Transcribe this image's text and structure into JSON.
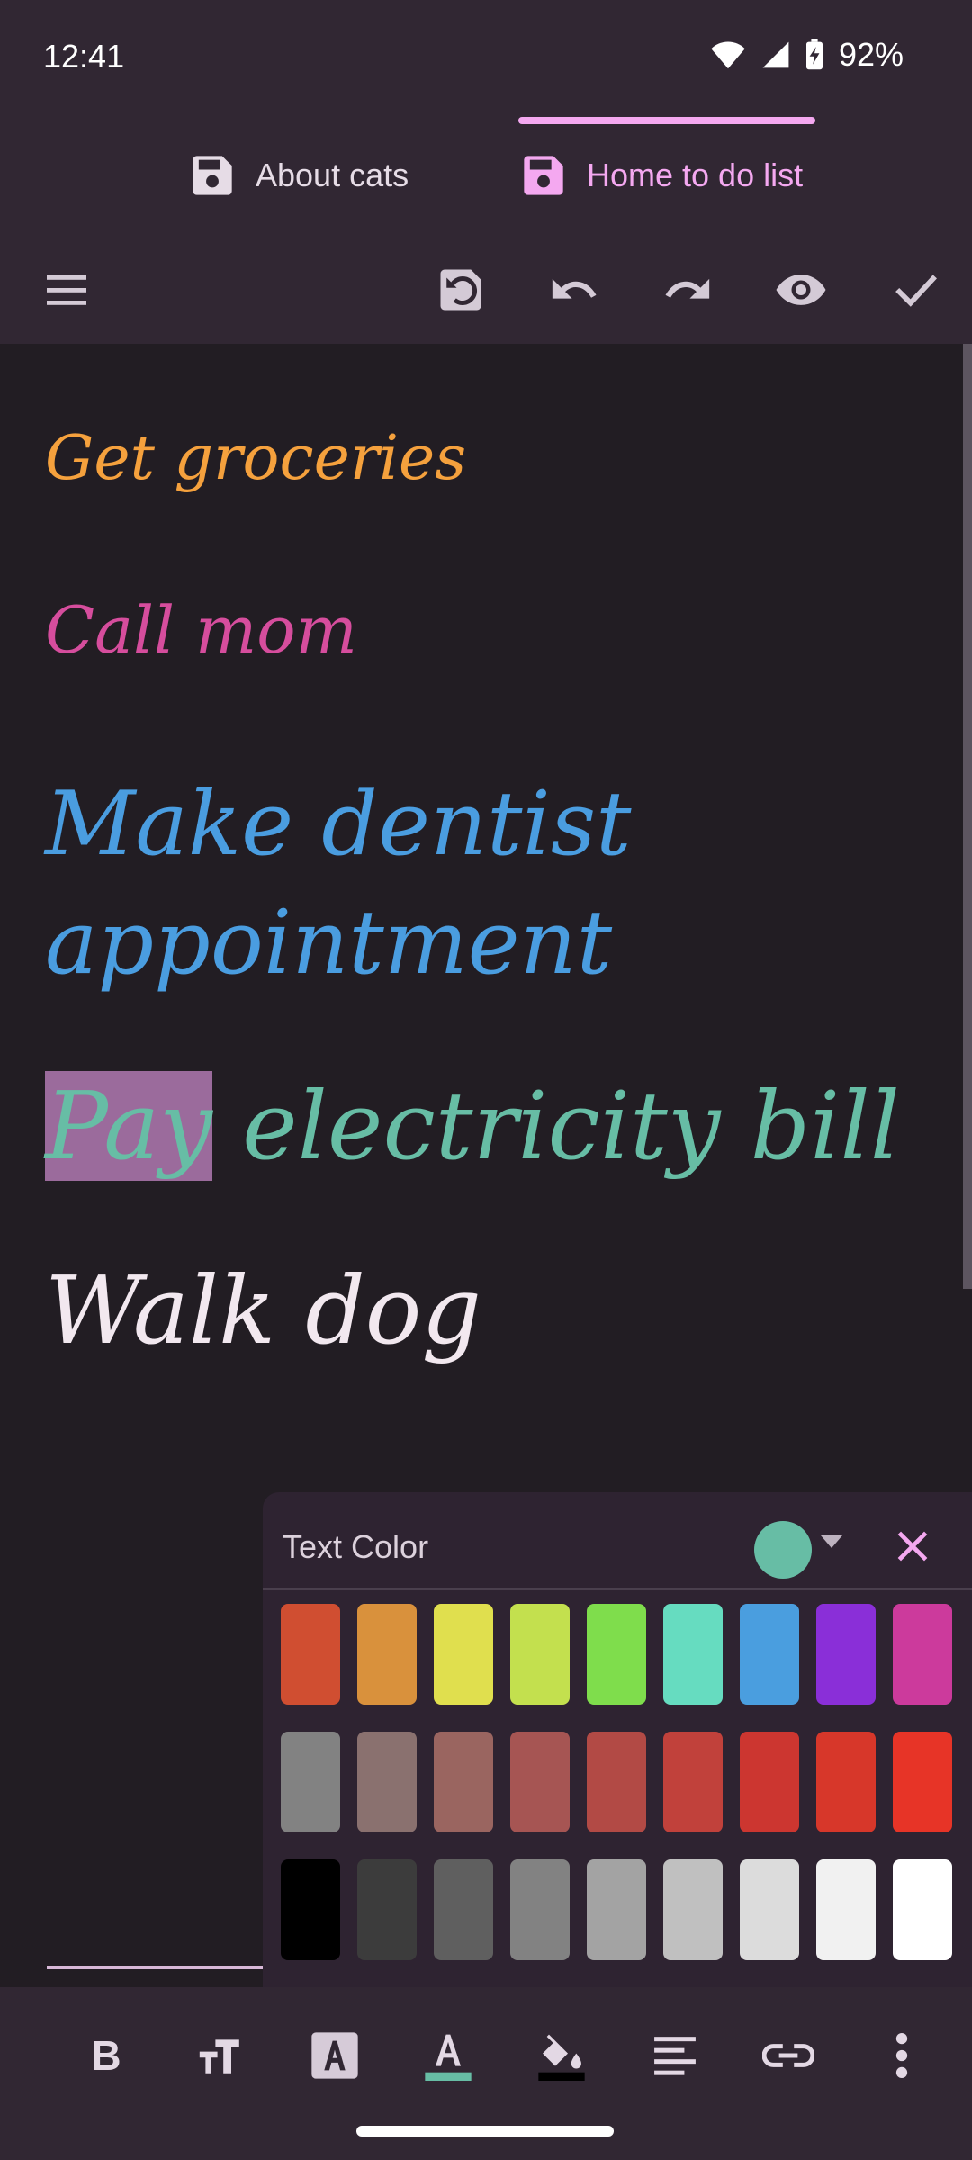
{
  "status": {
    "time": "12:41",
    "battery": "92%"
  },
  "tabs": [
    {
      "label": "About cats",
      "icon": "save-icon",
      "active": false
    },
    {
      "label": "Home to do list",
      "icon": "save-icon",
      "active": true
    }
  ],
  "toolbar": {
    "icons": [
      "menu-icon",
      "revert-save-icon",
      "undo-icon",
      "redo-icon",
      "preview-eye-icon",
      "done-check-icon"
    ]
  },
  "document": {
    "lines": [
      {
        "text": "Get groceries",
        "color": "#f5a13d"
      },
      {
        "text": "Call mom",
        "color": "#d64d9d"
      },
      {
        "text": "Make dentist appointment",
        "color": "#4a9de0"
      },
      {
        "text_selected": "Pay",
        "text_rest": " electricity bill",
        "color": "#67bda5"
      },
      {
        "text": "Walk dog",
        "color": "#f2e8ef"
      }
    ]
  },
  "color_picker": {
    "title": "Text Color",
    "current_color": "#67bda5",
    "rows": [
      [
        "#d04e31",
        "#d9913c",
        "#e0df4e",
        "#c3e04e",
        "#7fdd4c",
        "#66dcc0",
        "#4a9edf",
        "#8a2fd8",
        "#cc3a9c"
      ],
      [
        "#828282",
        "#8a716f",
        "#9a6560",
        "#a65553",
        "#b24a45",
        "#c1413b",
        "#cc3630",
        "#d7372a",
        "#e73427"
      ],
      [
        "#000000",
        "#3c3c3c",
        "#5f5f5f",
        "#828282",
        "#a3a3a3",
        "#c0c0c0",
        "#dcdcdc",
        "#f1f1f1",
        "#ffffff"
      ]
    ]
  },
  "format_bar": {
    "bold_label": "B",
    "icons": [
      "bold-icon",
      "text-size-icon",
      "text-highlight-icon",
      "text-color-icon",
      "fill-color-icon",
      "align-icon",
      "link-icon",
      "more-vert-icon"
    ],
    "text_color_underline": "#67bda5",
    "fill_color_underline": "#000000"
  }
}
